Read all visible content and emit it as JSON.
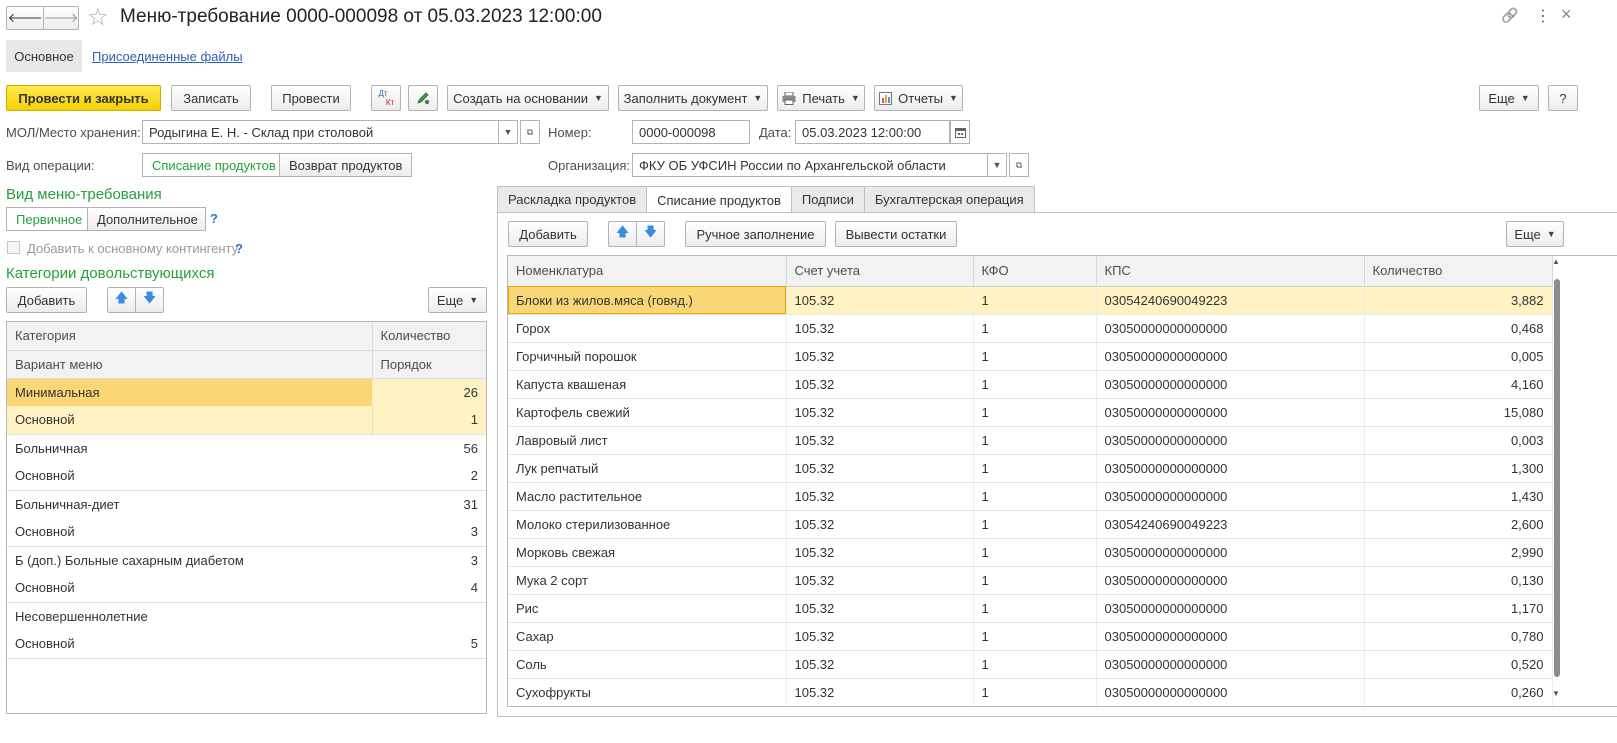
{
  "window": {
    "title": "Меню-требование 0000-000098 от 05.03.2023 12:00:00",
    "nav_back": "🡐",
    "nav_forward": "🡒",
    "star": "☆",
    "link_icon": "🔗",
    "more_icon": "⋮",
    "close_icon": "×"
  },
  "doc_tabs": {
    "main": "Основное",
    "attached": "Присоединенные файлы"
  },
  "toolbar": {
    "post_close": "Провести и закрыть",
    "save": "Записать",
    "post": "Провести",
    "dtkt_top": "Дт",
    "dtkt_bottom": "Кт",
    "create_based": "Создать на основании",
    "fill_document": "Заполнить документ",
    "print": "Печать",
    "reports": "Отчеты",
    "more": "Еще",
    "help": "?"
  },
  "header": {
    "mol_label": "МОЛ/Место хранения:",
    "mol_value": "Родыгина Е. Н. - Склад при столовой",
    "number_label": "Номер:",
    "number_value": "0000-000098",
    "date_label": "Дата:",
    "date_value": "05.03.2023 12:00:00",
    "operation_label": "Вид операции:",
    "op_write_off": "Списание продуктов",
    "op_return": "Возврат продуктов",
    "org_label": "Организация:",
    "org_value": "ФКУ ОБ УФСИН России по Архангельской области"
  },
  "left": {
    "menu_type_title": "Вид меню-требования",
    "primary": "Первичное",
    "additional": "Дополнительное",
    "qmark": "?",
    "add_to_main": "Добавить к основному контингенту",
    "categories_title": "Категории довольствующихся",
    "add": "Добавить",
    "more": "Еще",
    "col_category": "Категория",
    "col_quantity": "Количество",
    "col_menu_variant": "Вариант меню",
    "col_order": "Порядок",
    "rows": [
      {
        "category": "Минимальная",
        "quantity": "26",
        "menu": "Основной",
        "order": "1"
      },
      {
        "category": "Больничная",
        "quantity": "56",
        "menu": "Основной",
        "order": "2"
      },
      {
        "category": "Больничная-диет",
        "quantity": "31",
        "menu": "Основной",
        "order": "3"
      },
      {
        "category": "Б (доп.) Больные сахарным диабетом",
        "quantity": "3",
        "menu": "Основной",
        "order": "4"
      },
      {
        "category": "Несовершеннолетние",
        "quantity": "",
        "menu": "Основной",
        "order": "5"
      }
    ]
  },
  "right": {
    "tabs": [
      "Раскладка продуктов",
      "Списание продуктов",
      "Подписи",
      "Бухгалтерская операция"
    ],
    "add": "Добавить",
    "manual_fill": "Ручное заполнение",
    "show_balances": "Вывести остатки",
    "more": "Еще",
    "columns": [
      "Номенклатура",
      "Счет учета",
      "КФО",
      "КПС",
      "Количество"
    ],
    "rows": [
      {
        "name": "Блоки из жилов.мяса (говяд.)",
        "account": "105.32",
        "kfo": "1",
        "kps": "03054240690049223",
        "qty": "3,882"
      },
      {
        "name": "Горох",
        "account": "105.32",
        "kfo": "1",
        "kps": "03050000000000000",
        "qty": "0,468"
      },
      {
        "name": "Горчичный порошок",
        "account": "105.32",
        "kfo": "1",
        "kps": "03050000000000000",
        "qty": "0,005"
      },
      {
        "name": "Капуста квашеная",
        "account": "105.32",
        "kfo": "1",
        "kps": "03050000000000000",
        "qty": "4,160"
      },
      {
        "name": "Картофель свежий",
        "account": "105.32",
        "kfo": "1",
        "kps": "03050000000000000",
        "qty": "15,080"
      },
      {
        "name": "Лавровый лист",
        "account": "105.32",
        "kfo": "1",
        "kps": "03050000000000000",
        "qty": "0,003"
      },
      {
        "name": "Лук репчатый",
        "account": "105.32",
        "kfo": "1",
        "kps": "03050000000000000",
        "qty": "1,300"
      },
      {
        "name": "Масло растительное",
        "account": "105.32",
        "kfo": "1",
        "kps": "03050000000000000",
        "qty": "1,430"
      },
      {
        "name": "Молоко стерилизованное",
        "account": "105.32",
        "kfo": "1",
        "kps": "03054240690049223",
        "qty": "2,600"
      },
      {
        "name": "Морковь свежая",
        "account": "105.32",
        "kfo": "1",
        "kps": "03050000000000000",
        "qty": "2,990"
      },
      {
        "name": "Мука 2 сорт",
        "account": "105.32",
        "kfo": "1",
        "kps": "03050000000000000",
        "qty": "0,130"
      },
      {
        "name": "Рис",
        "account": "105.32",
        "kfo": "1",
        "kps": "03050000000000000",
        "qty": "1,170"
      },
      {
        "name": "Сахар",
        "account": "105.32",
        "kfo": "1",
        "kps": "03050000000000000",
        "qty": "0,780"
      },
      {
        "name": "Соль",
        "account": "105.32",
        "kfo": "1",
        "kps": "03050000000000000",
        "qty": "0,520"
      },
      {
        "name": "Сухофрукты",
        "account": "105.32",
        "kfo": "1",
        "kps": "03050000000000000",
        "qty": "0,260"
      }
    ]
  },
  "colors": {
    "accent_yellow": "#f3d100",
    "green_text": "#27a038",
    "link_blue": "#2f5fb3",
    "selected_row": "#fff3c4",
    "focused_cell": "#fad776"
  }
}
